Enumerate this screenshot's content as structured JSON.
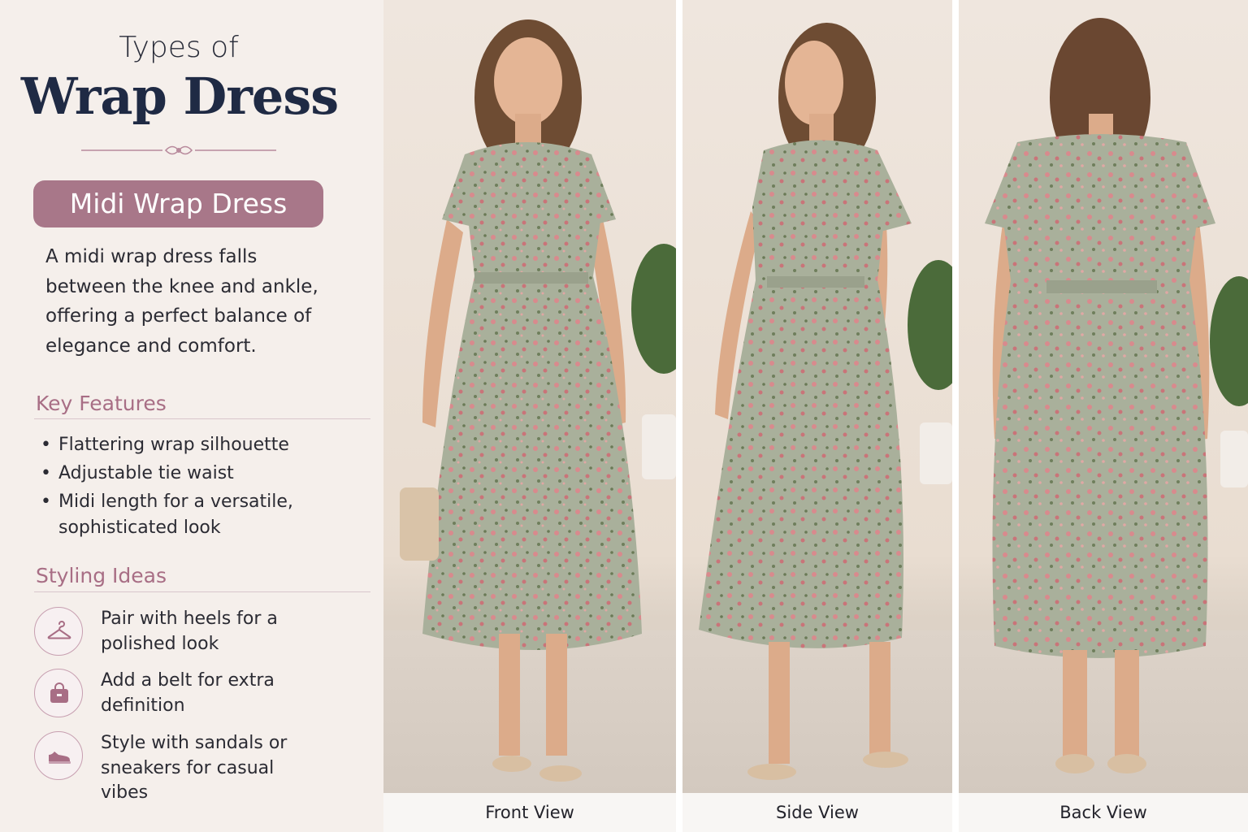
{
  "header": {
    "kicker": "Types of",
    "title": "Wrap Dress"
  },
  "type_pill": "Midi Wrap Dress",
  "description": "A midi wrap dress falls between the knee and ankle, offering a perfect balance of elegance and comfort.",
  "key_features": {
    "heading": "Key Features",
    "items": [
      "Flattering wrap silhouette",
      "Adjustable tie waist",
      "Midi length for a versatile, sophisticated look"
    ]
  },
  "styling_ideas": {
    "heading": "Styling Ideas",
    "items": [
      {
        "icon": "hanger-icon",
        "text": "Pair with heels for a polished look"
      },
      {
        "icon": "handbag-icon",
        "text": "Add a belt for extra definition"
      },
      {
        "icon": "sneaker-icon",
        "text": "Style with sandals or sneakers for casual vibes"
      }
    ]
  },
  "views": [
    {
      "caption": "Front View"
    },
    {
      "caption": "Side View"
    },
    {
      "caption": "Back View"
    }
  ],
  "colors": {
    "accent_pink": "#a87789",
    "heading_pink": "#a86e85",
    "navy": "#1f2a44",
    "dress_sage": "#a7ae98",
    "floral_pink": "#d88a8d"
  }
}
